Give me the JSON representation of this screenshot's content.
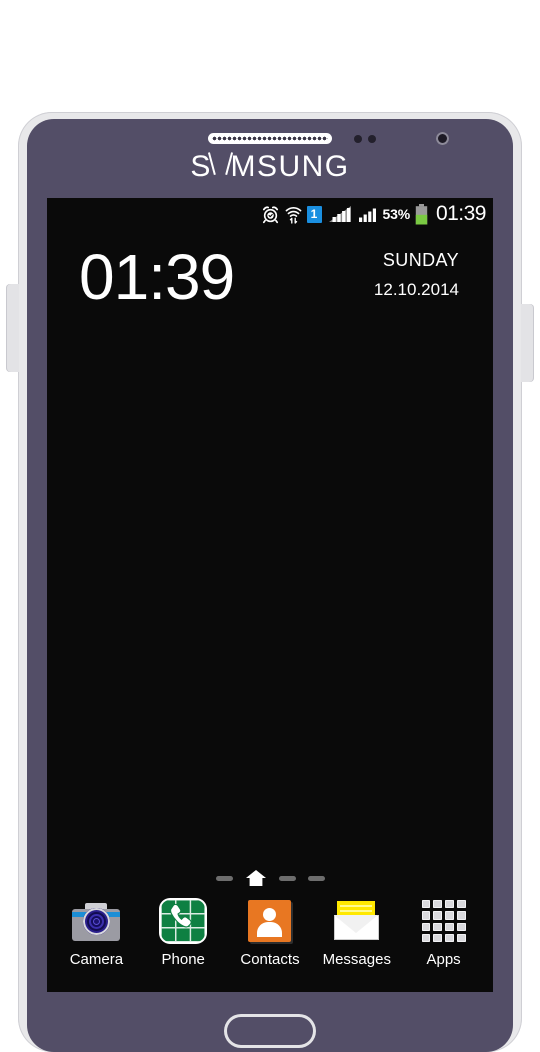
{
  "device": {
    "brand": "SAMSUNG",
    "brand_prefix": "S",
    "brand_suffix": "MSUNG",
    "bezel_color": "#534e67",
    "frame_color": "#e8e8ea",
    "hardware": {
      "earpiece": "earpiece-speaker",
      "front_camera": "front-camera",
      "home_button": "home-button",
      "volume_button": "volume-button",
      "power_button": "power-button"
    }
  },
  "screen": {
    "background_color": "#0a0a0a",
    "status_bar": {
      "icons": [
        {
          "name": "alarm-clock-icon",
          "label": "Alarm"
        },
        {
          "name": "wifi-transfer-icon",
          "label": "Wi-Fi"
        }
      ],
      "sim_badge": "1",
      "signal_1": "signal-bars-sim1",
      "signal_2": "signal-bars-sim2",
      "battery_percent": "53%",
      "battery_level": 53,
      "battery_color": "#7ac943",
      "clock": "01:39"
    },
    "clock_widget": {
      "time": "01:39",
      "day": "SUNDAY",
      "date": "12.10.2014"
    },
    "page_indicator": {
      "pages": [
        {
          "name": "page-dash",
          "active": false
        },
        {
          "name": "page-home",
          "active": true
        },
        {
          "name": "page-dash",
          "active": false
        },
        {
          "name": "page-dash",
          "active": false
        }
      ]
    },
    "dock": {
      "items": [
        {
          "label": "Camera",
          "icon": "camera-icon",
          "accent": "#1b8ed6"
        },
        {
          "label": "Phone",
          "icon": "phone-icon",
          "accent": "#0e8042"
        },
        {
          "label": "Contacts",
          "icon": "contacts-icon",
          "accent": "#e87722"
        },
        {
          "label": "Messages",
          "icon": "messages-icon",
          "accent": "#ffe800"
        },
        {
          "label": "Apps",
          "icon": "apps-grid-icon",
          "accent": "#d9d9dd"
        }
      ]
    }
  }
}
